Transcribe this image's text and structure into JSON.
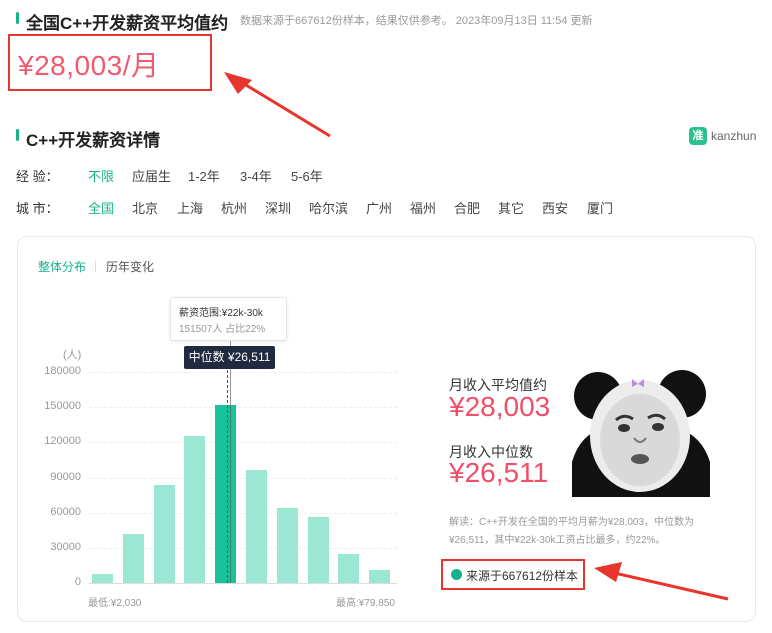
{
  "header": {
    "title": "全国C++开发薪资平均值约",
    "meta": "数据来源于667612份样本，结果仅供参考。  2023年09月13日 11:54 更新",
    "average_display": "¥28,003/月"
  },
  "detail": {
    "title": "C++开发薪资详情",
    "brand_text": "kanzhun",
    "brand_logo": "准"
  },
  "filters": {
    "experience": {
      "label": "经    验：",
      "options": [
        "不限",
        "应届生",
        "1-2年",
        "3-4年",
        "5-6年"
      ],
      "selected": "不限"
    },
    "city": {
      "label": "城    市：",
      "options": [
        "全国",
        "北京",
        "上海",
        "杭州",
        "深圳",
        "哈尔滨",
        "广州",
        "福州",
        "合肥",
        "其它",
        "西安",
        "厦门"
      ],
      "selected": "全国"
    }
  },
  "tabs": [
    "整体分布",
    "历年变化"
  ],
  "tooltip": {
    "range": "薪资范围:¥22k-30k",
    "detail": "151507人  占比22%"
  },
  "median_tag": "中位数 ¥26,511",
  "chart_data": {
    "type": "bar",
    "ylabel": "(人)",
    "ylim": [
      0,
      180000
    ],
    "yticks": [
      "180000",
      "150000",
      "120000",
      "90000",
      "60000",
      "30000",
      "0"
    ],
    "values": [
      8000,
      42000,
      84000,
      125000,
      151507,
      96000,
      64000,
      56000,
      25000,
      11000
    ],
    "highlight_index": 4,
    "min_label": "最低:¥2,030",
    "max_label": "最高:¥79,850",
    "colors": {
      "bar": "#9ce6d4",
      "highlight": "#19c39a"
    }
  },
  "stats": {
    "avg_label": "月收入平均值约",
    "avg_value": "¥28,003",
    "median_label": "月收入中位数",
    "median_value": "¥26,511"
  },
  "note": "解读：C++开发在全国的平均月薪为¥28,003，中位数为¥26,511，其中¥22k-30k工资占比最多，约22%。",
  "source": "来源于667612份样本",
  "colors": {
    "accent": "#18b38a",
    "salary": "#ef4f69",
    "annotation": "#e8352e"
  }
}
